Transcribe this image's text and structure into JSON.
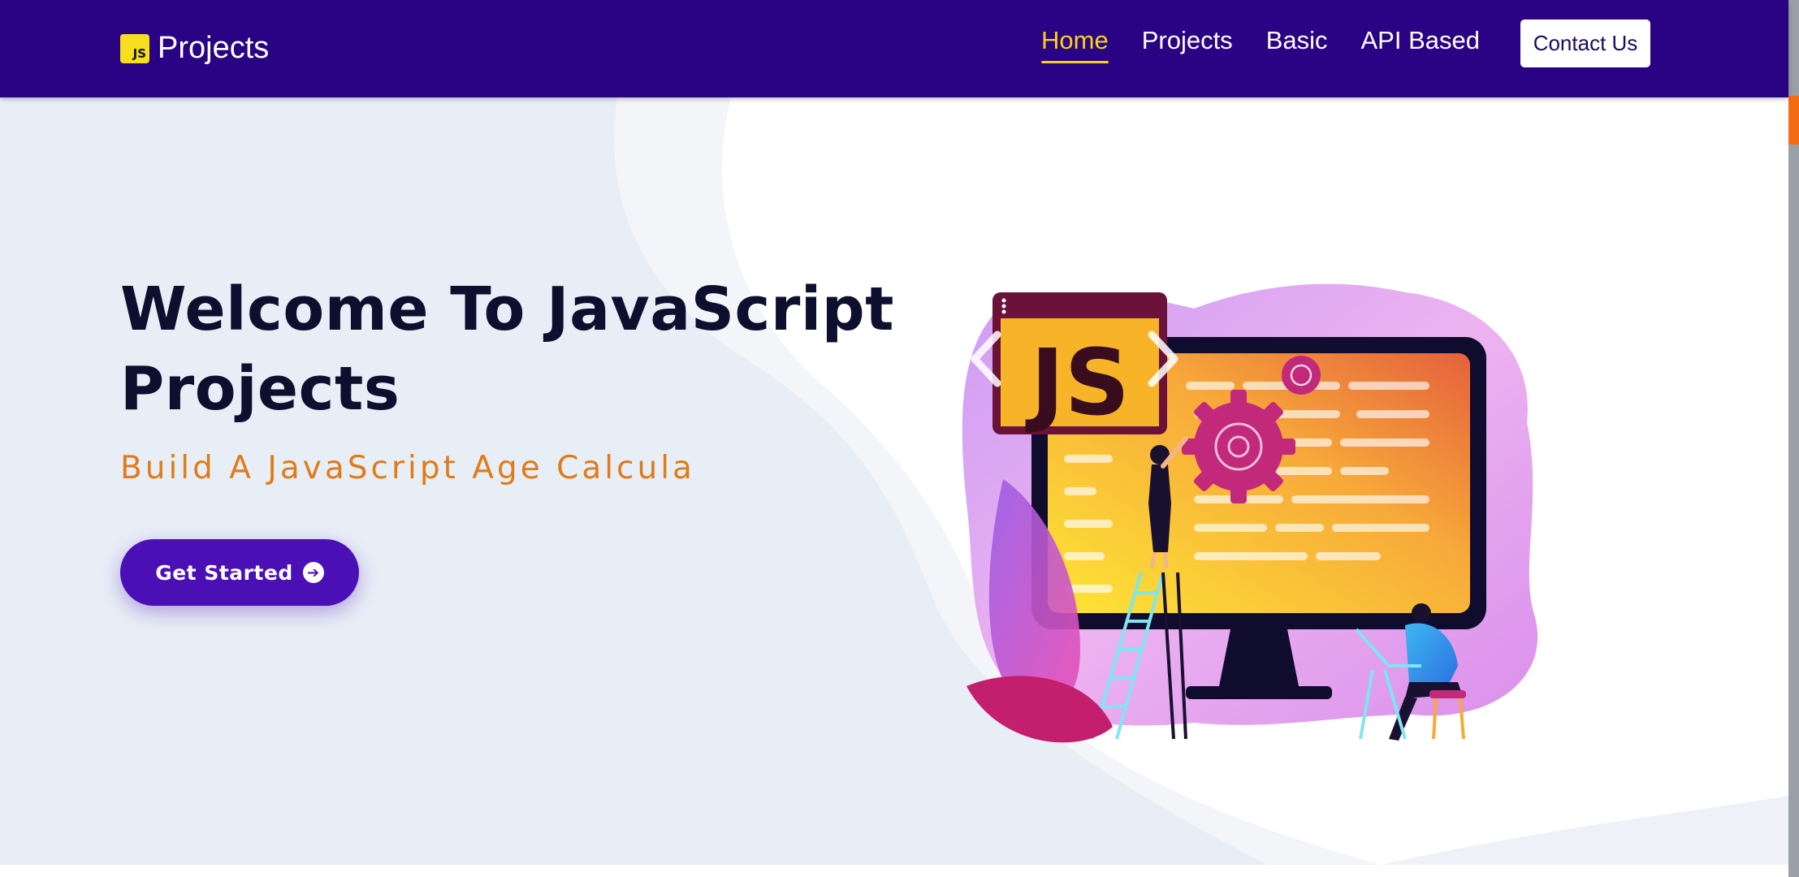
{
  "brand": {
    "badge": "JS",
    "name": "Projects"
  },
  "nav": {
    "items": [
      {
        "label": "Home",
        "active": true
      },
      {
        "label": "Projects",
        "active": false
      },
      {
        "label": "Basic",
        "active": false
      },
      {
        "label": "API Based",
        "active": false
      }
    ],
    "contact_label": "Contact Us"
  },
  "hero": {
    "title_line1": "Welcome To JavaScript",
    "title_line2": "Projects",
    "subtitle": "Build A JavaScript Age Calcula",
    "cta_label": "Get Started",
    "illustration_badge": "JS"
  },
  "icons": {
    "cta": "arrow-circle-right-icon",
    "carousel_prev": "chevron-left-icon",
    "carousel_next": "chevron-right-icon"
  },
  "colors": {
    "navbar": "#2a0384",
    "accent_active": "#f7d417",
    "button": "#4a0fb5",
    "subtitle": "#e07b1a",
    "title": "#0d0f2e",
    "scroll_thumb": "#f36b12"
  }
}
